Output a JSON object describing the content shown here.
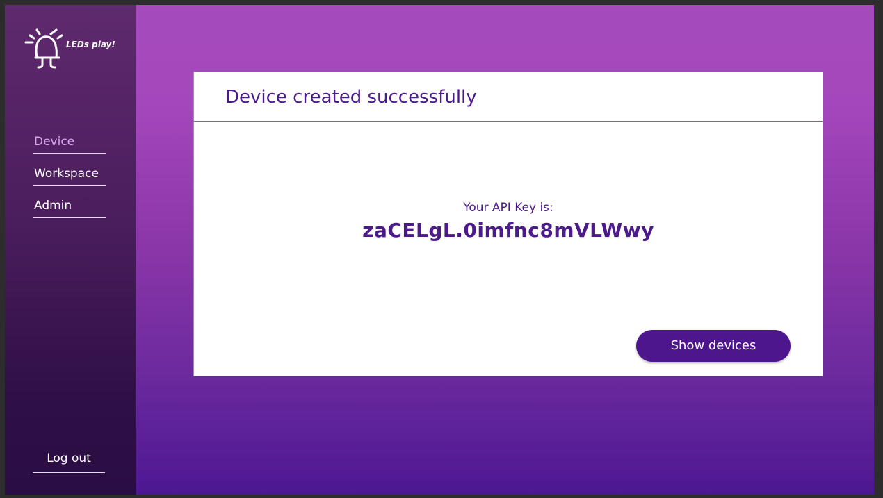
{
  "brand": {
    "name": "LEDs play!"
  },
  "sidebar": {
    "items": [
      {
        "label": "Device",
        "active": true
      },
      {
        "label": "Workspace",
        "active": false
      },
      {
        "label": "Admin",
        "active": false
      }
    ],
    "logout_label": "Log out"
  },
  "card": {
    "title": "Device created successfully",
    "api_key_label": "Your API Key is:",
    "api_key_value": "zaCELgL.0imfnc8mVLWwy",
    "button_label": "Show devices"
  },
  "colors": {
    "accent": "#4d168c",
    "active_nav": "#d9a6f2",
    "text_primary": "#4d1a8c"
  }
}
